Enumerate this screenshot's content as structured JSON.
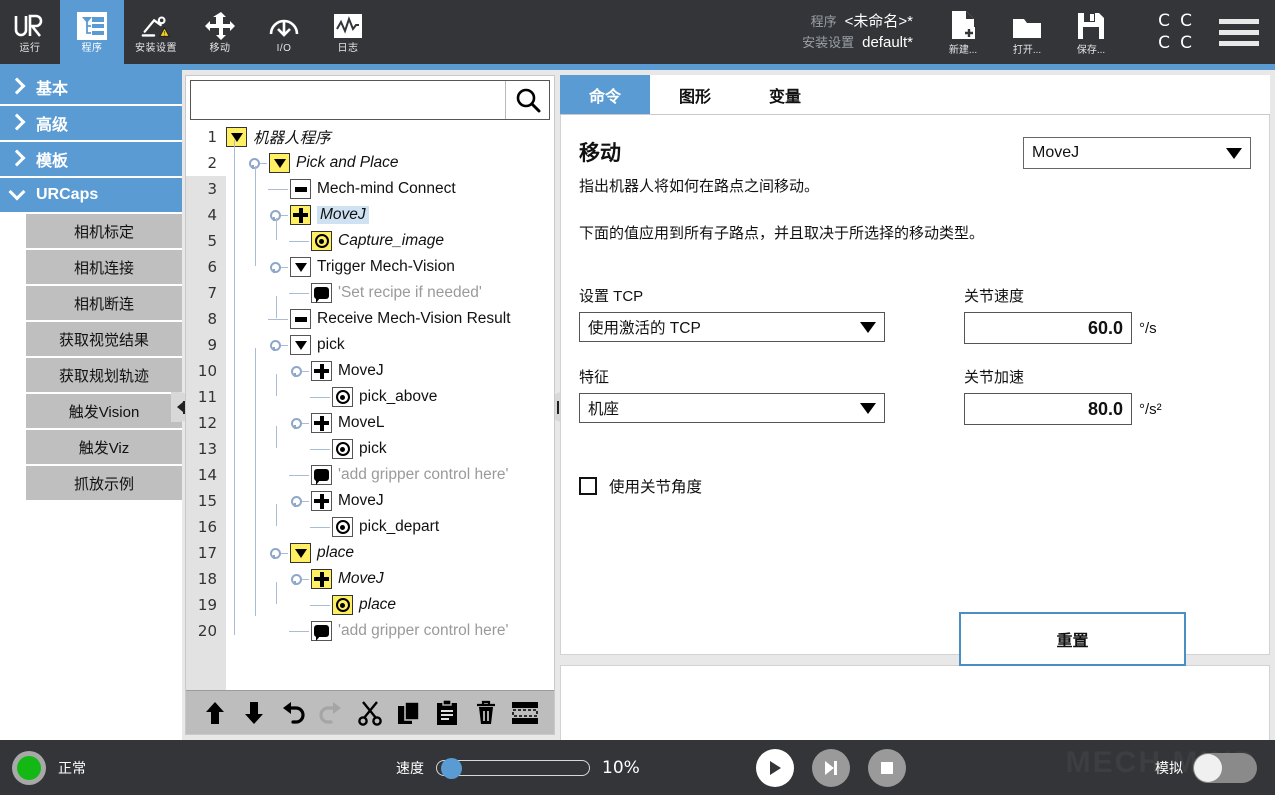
{
  "header": {
    "tabs": [
      {
        "label": "运行",
        "icon": "ur-logo-icon",
        "active": false
      },
      {
        "label": "程序",
        "icon": "program-icon",
        "active": true
      },
      {
        "label": "安装设置",
        "icon": "installation-icon",
        "active": false
      },
      {
        "label": "移动",
        "icon": "move-icon",
        "active": false
      },
      {
        "label": "I/O",
        "icon": "io-icon",
        "active": false
      },
      {
        "label": "日志",
        "icon": "log-icon",
        "active": false
      }
    ],
    "meta": {
      "program_key": "程序",
      "program_value": "<未命名>*",
      "installation_key": "安装设置",
      "installation_value": "default*"
    },
    "file_buttons": [
      {
        "label": "新建...",
        "icon": "new-file-icon"
      },
      {
        "label": "打开...",
        "icon": "open-folder-icon"
      },
      {
        "label": "保存...",
        "icon": "save-disk-icon"
      }
    ],
    "cc_grid": [
      "C",
      "C",
      "C",
      "C"
    ],
    "menu_icon": "hamburger-menu-icon",
    "accent_color": "#5a9bd4"
  },
  "sidebar": {
    "categories": [
      {
        "label": "基本",
        "expanded": false
      },
      {
        "label": "高级",
        "expanded": false
      },
      {
        "label": "模板",
        "expanded": false
      },
      {
        "label": "URCaps",
        "expanded": true
      }
    ],
    "urcaps": [
      "相机标定",
      "相机连接",
      "相机断连",
      "获取视觉结果",
      "获取规划轨迹",
      "触发Vision",
      "触发Viz",
      "抓放示例"
    ]
  },
  "tree": {
    "search_placeholder": "",
    "search_value": "",
    "search_icon": "search-icon",
    "rows": [
      {
        "n": "1",
        "indent": 0,
        "icon": "triangle",
        "iconStyle": "yellow",
        "text": "机器人程序",
        "italic": true,
        "grey": false,
        "selected": false,
        "pin": false
      },
      {
        "n": "2",
        "indent": 1,
        "icon": "triangle",
        "iconStyle": "yellow",
        "text": "Pick and Place",
        "italic": true,
        "grey": false,
        "selected": false,
        "pin": true
      },
      {
        "n": "3",
        "indent": 2,
        "icon": "dash",
        "iconStyle": "plain",
        "text": "Mech-mind Connect",
        "italic": false,
        "grey": false,
        "selected": false,
        "pin": false
      },
      {
        "n": "4",
        "indent": 2,
        "icon": "move",
        "iconStyle": "yellow",
        "text": "MoveJ",
        "italic": true,
        "grey": false,
        "selected": true,
        "pin": true
      },
      {
        "n": "5",
        "indent": 3,
        "icon": "waypoint",
        "iconStyle": "yellow",
        "text": "Capture_image",
        "italic": true,
        "grey": false,
        "selected": false,
        "pin": false
      },
      {
        "n": "6",
        "indent": 2,
        "icon": "triangle",
        "iconStyle": "plain",
        "text": "Trigger Mech-Vision",
        "italic": false,
        "grey": false,
        "selected": false,
        "pin": true
      },
      {
        "n": "7",
        "indent": 3,
        "icon": "comment",
        "iconStyle": "plain",
        "text": "'Set recipe if needed'",
        "italic": false,
        "grey": true,
        "selected": false,
        "pin": false
      },
      {
        "n": "8",
        "indent": 2,
        "icon": "dash",
        "iconStyle": "plain",
        "text": "Receive Mech-Vision Result",
        "italic": false,
        "grey": false,
        "selected": false,
        "pin": false
      },
      {
        "n": "9",
        "indent": 2,
        "icon": "triangle",
        "iconStyle": "plain",
        "text": "pick",
        "italic": false,
        "grey": false,
        "selected": false,
        "pin": true
      },
      {
        "n": "10",
        "indent": 3,
        "icon": "move",
        "iconStyle": "plain",
        "text": "MoveJ",
        "italic": false,
        "grey": false,
        "selected": false,
        "pin": true
      },
      {
        "n": "11",
        "indent": 4,
        "icon": "waypoint",
        "iconStyle": "plain",
        "text": "pick_above",
        "italic": false,
        "grey": false,
        "selected": false,
        "pin": false
      },
      {
        "n": "12",
        "indent": 3,
        "icon": "move",
        "iconStyle": "plain",
        "text": "MoveL",
        "italic": false,
        "grey": false,
        "selected": false,
        "pin": true
      },
      {
        "n": "13",
        "indent": 4,
        "icon": "waypoint",
        "iconStyle": "plain",
        "text": "pick",
        "italic": false,
        "grey": false,
        "selected": false,
        "pin": false
      },
      {
        "n": "14",
        "indent": 3,
        "icon": "comment",
        "iconStyle": "plain",
        "text": "'add gripper control here'",
        "italic": false,
        "grey": true,
        "selected": false,
        "pin": false
      },
      {
        "n": "15",
        "indent": 3,
        "icon": "move",
        "iconStyle": "plain",
        "text": "MoveJ",
        "italic": false,
        "grey": false,
        "selected": false,
        "pin": true
      },
      {
        "n": "16",
        "indent": 4,
        "icon": "waypoint",
        "iconStyle": "plain",
        "text": "pick_depart",
        "italic": false,
        "grey": false,
        "selected": false,
        "pin": false
      },
      {
        "n": "17",
        "indent": 2,
        "icon": "triangle",
        "iconStyle": "yellow",
        "text": "place",
        "italic": true,
        "grey": false,
        "selected": false,
        "pin": true
      },
      {
        "n": "18",
        "indent": 3,
        "icon": "move",
        "iconStyle": "yellow",
        "text": "MoveJ",
        "italic": true,
        "grey": false,
        "selected": false,
        "pin": true
      },
      {
        "n": "19",
        "indent": 4,
        "icon": "waypoint",
        "iconStyle": "yellow",
        "text": "place",
        "italic": true,
        "grey": false,
        "selected": false,
        "pin": false
      },
      {
        "n": "20",
        "indent": 3,
        "icon": "comment",
        "iconStyle": "plain",
        "text": "'add gripper control here'",
        "italic": false,
        "grey": true,
        "selected": false,
        "pin": false
      }
    ],
    "toolbar": [
      {
        "name": "move-up-button",
        "icon": "arrow-up-icon"
      },
      {
        "name": "move-down-button",
        "icon": "arrow-down-icon"
      },
      {
        "name": "undo-button",
        "icon": "undo-icon"
      },
      {
        "name": "redo-button",
        "icon": "redo-icon"
      },
      {
        "name": "cut-button",
        "icon": "scissors-icon"
      },
      {
        "name": "copy-button",
        "icon": "copy-icon"
      },
      {
        "name": "paste-button",
        "icon": "paste-icon"
      },
      {
        "name": "delete-button",
        "icon": "trash-icon"
      },
      {
        "name": "suppress-button",
        "icon": "suppress-icon"
      }
    ]
  },
  "right": {
    "tabs": [
      {
        "label": "命令",
        "active": true
      },
      {
        "label": "图形",
        "active": false
      },
      {
        "label": "变量",
        "active": false
      }
    ],
    "title": "移动",
    "desc1": "指出机器人将如何在路点之间移动。",
    "desc2": "下面的值应用到所有子路点，并且取决于所选择的移动类型。",
    "move_type": "MoveJ",
    "fields": {
      "tcp_label": "设置 TCP",
      "tcp_value": "使用激活的 TCP",
      "feature_label": "特征",
      "feature_value": "机座",
      "joint_speed_label": "关节速度",
      "joint_speed_value": "60.0",
      "joint_speed_unit": "°/s",
      "joint_accel_label": "关节加速",
      "joint_accel_value": "80.0",
      "joint_accel_unit": "°/s²"
    },
    "checkbox_label": "使用关节角度",
    "checkbox_checked": false,
    "reset_label": "重置"
  },
  "footer": {
    "status_text": "正常",
    "status_color": "#14b814",
    "speed_label": "速度",
    "speed_percent": "10%",
    "speed_value": 10,
    "play_icon": "play-icon",
    "step_icon": "step-icon",
    "stop_icon": "stop-icon",
    "sim_label": "模拟",
    "sim_on": false,
    "watermark": "MECH MIND"
  }
}
